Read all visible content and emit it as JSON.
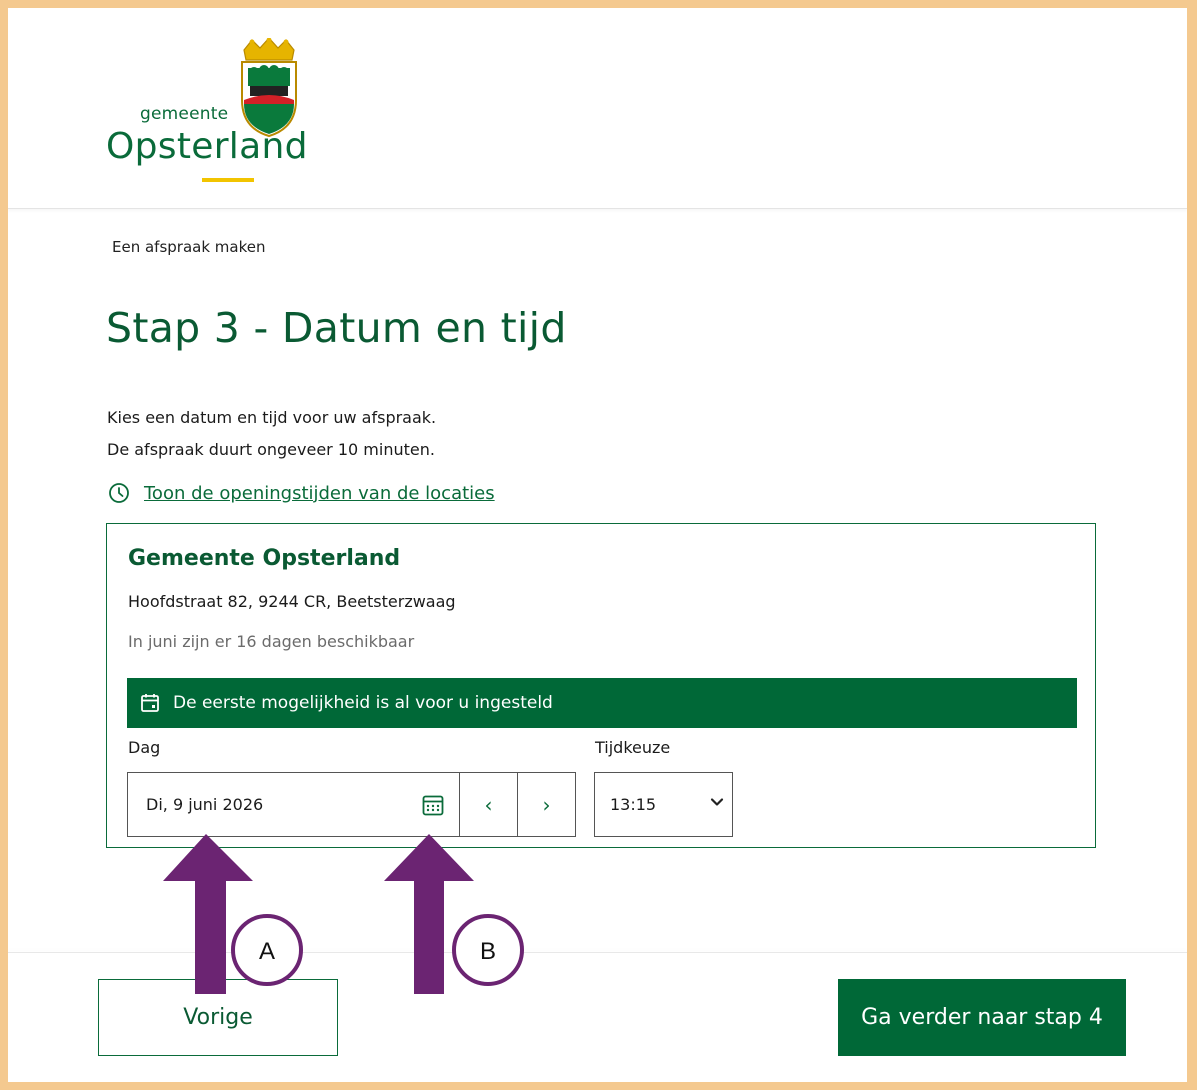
{
  "header": {
    "logo_small": "gemeente",
    "logo_big": "Opsterland"
  },
  "breadcrumb": "Een afspraak maken",
  "title": "Stap 3 - Datum en tijd",
  "intro": [
    "Kies een datum en tijd voor uw afspraak.",
    "De afspraak duurt ongeveer 10 minuten."
  ],
  "hours_link": {
    "icon": "clock-icon",
    "label": "Toon de openingstijden van de locaties"
  },
  "location": {
    "name": "Gemeente Opsterland",
    "address": "Hoofdstraat 82, 9244 CR, Beetsterzwaag",
    "availability": "In juni zijn er 16 dagen beschikbaar",
    "banner": "De eerste mogelijkheid is al voor u ingesteld",
    "banner_icon": "calendar-icon"
  },
  "form": {
    "day_label": "Dag",
    "day_value": "Di, 9 juni 2026",
    "time_label": "Tijdkeuze",
    "time_value": "13:15",
    "prev_glyph": "‹",
    "next_glyph": "›"
  },
  "footer": {
    "prev_label": "Vorige",
    "next_label": "Ga verder naar stap 4"
  },
  "annotations": {
    "marker_a": "A",
    "marker_b": "B"
  },
  "colors": {
    "brand_green": "#006837",
    "text_green": "#0a5a33",
    "frame": "#f4c98f",
    "arrow_purple": "#6b2472",
    "logo_yellow": "#f2c400"
  }
}
